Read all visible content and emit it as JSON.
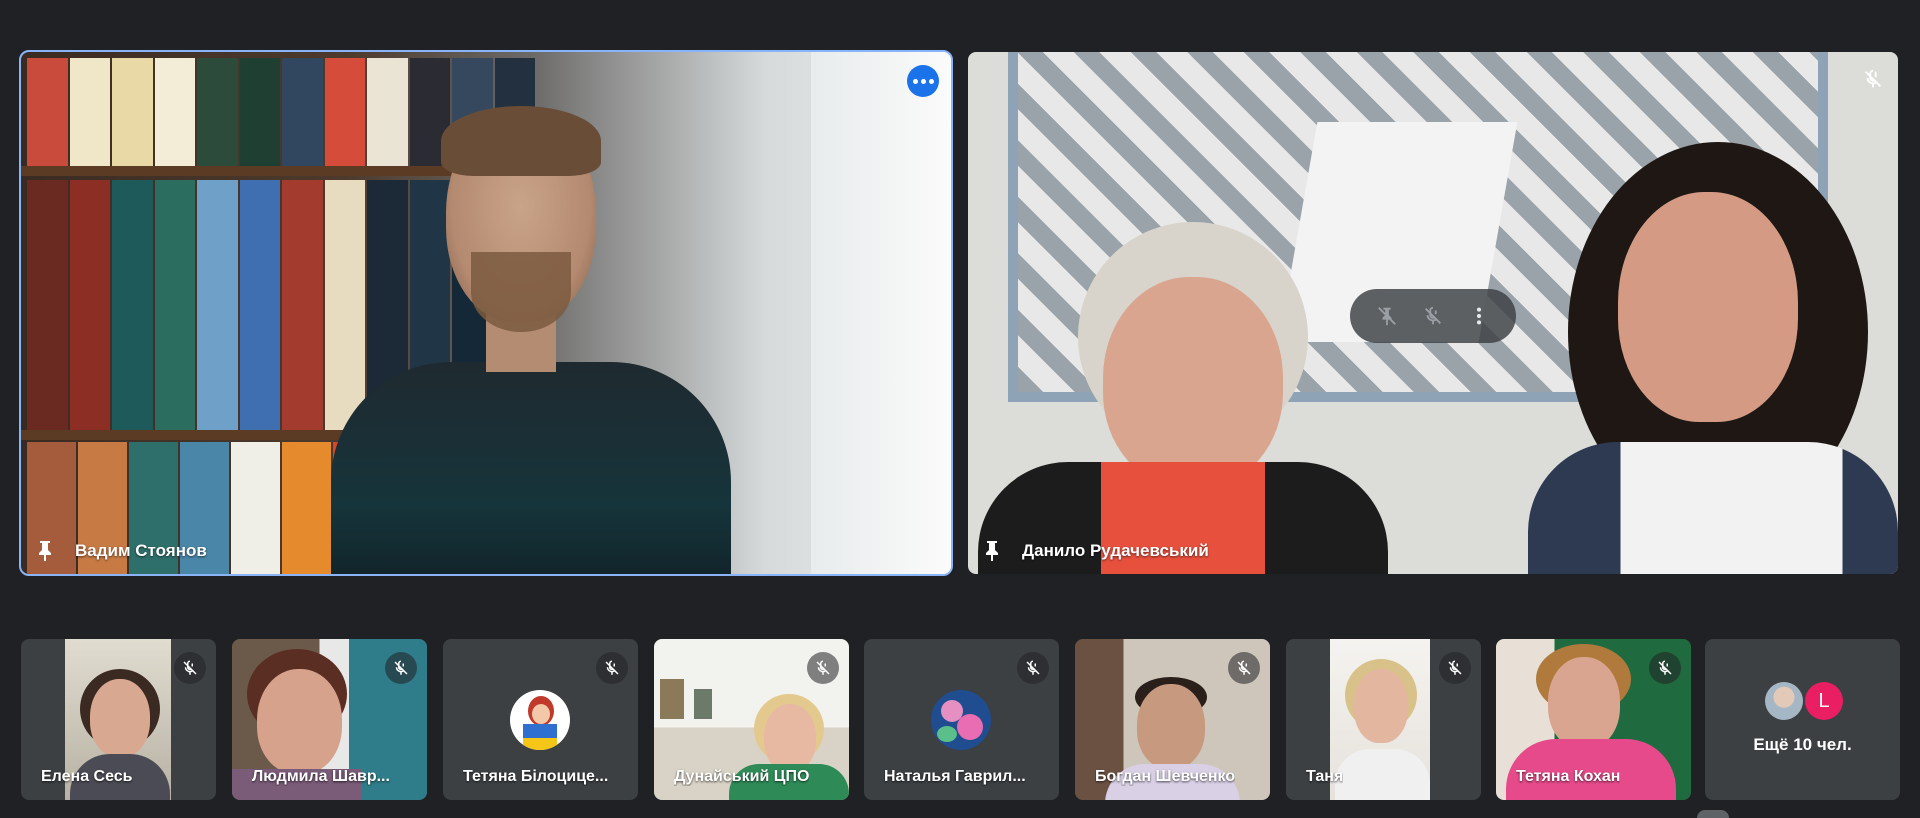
{
  "colors": {
    "background": "#202124",
    "tile": "#3c4043",
    "active_speaker_outline": "#8ab4f8",
    "more_button": "#1a73e8",
    "avatar_l": "#e91e63"
  },
  "main_tiles": [
    {
      "name": "Вадим Стоянов",
      "pinned": true,
      "active_speaker": true,
      "icons": [
        "pin-icon",
        "more-options-icon"
      ]
    },
    {
      "name": "Данило Рудачевський",
      "pinned": true,
      "muted": true,
      "icons": [
        "pin-icon",
        "mic-off-icon",
        "unpin-icon",
        "more-vert-icon"
      ]
    }
  ],
  "thumbnails": [
    {
      "name": "Елена Сесь",
      "muted": true,
      "type": "video"
    },
    {
      "name": "Людмила Шавр...",
      "muted": true,
      "type": "video"
    },
    {
      "name": "Тетяна Білоцице...",
      "muted": true,
      "type": "avatar"
    },
    {
      "name": "Дунайський ЦПО",
      "muted": true,
      "type": "video"
    },
    {
      "name": "Наталья Гаврил...",
      "muted": true,
      "type": "avatar"
    },
    {
      "name": "Богдан Шевченко",
      "muted": true,
      "type": "video"
    },
    {
      "name": "Таня",
      "muted": true,
      "type": "video"
    },
    {
      "name": "Тетяна Кохан",
      "muted": true,
      "type": "video"
    }
  ],
  "more_participants": {
    "label": "Ещё 10 чел.",
    "avatar_letter": "L"
  }
}
